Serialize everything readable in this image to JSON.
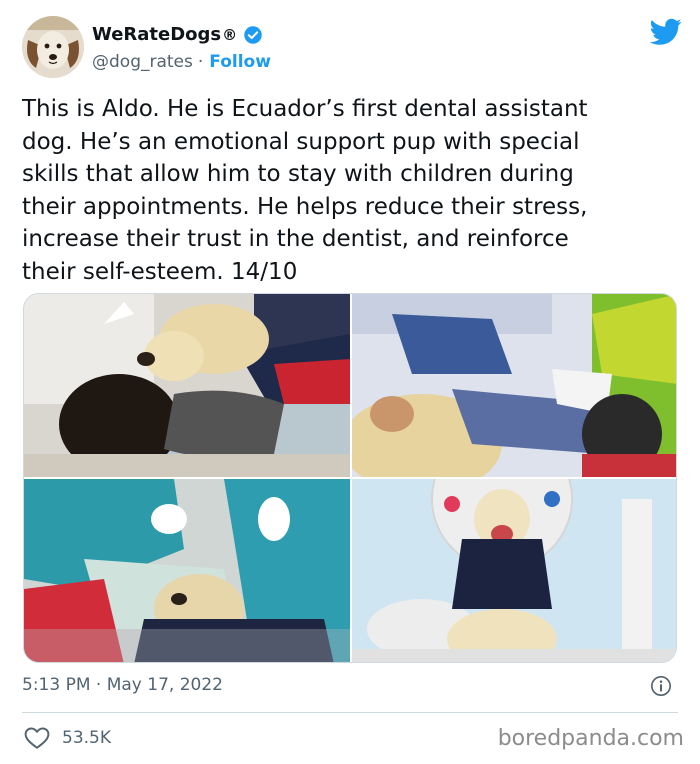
{
  "tweet": {
    "author_name": "WeRateDogs",
    "registered_mark": "®",
    "handle": "@dog_rates",
    "separator": "·",
    "follow_label": "Follow",
    "text_lines": [
      "This is Aldo. He is Ecuador’s first dental assistant",
      "dog. He’s an emotional support pup with special",
      "skills that allow him to stay with children during",
      "their appointments. He helps reduce their stress,",
      "increase their trust in the dentist, and reinforce",
      "their self-esteem. 14/10"
    ],
    "time": "5:13 PM",
    "date": "May 17, 2022",
    "like_count": "53.5K"
  },
  "watermark": "boredpanda.com",
  "colors": {
    "accent": "#1d9bf0",
    "text": "#0f1419",
    "secondary_text": "#536471",
    "divider": "#cfd9de"
  },
  "icons": {
    "verified": "verified-badge-icon",
    "platform": "twitter-bird-icon",
    "info": "info-icon",
    "like": "heart-icon"
  }
}
